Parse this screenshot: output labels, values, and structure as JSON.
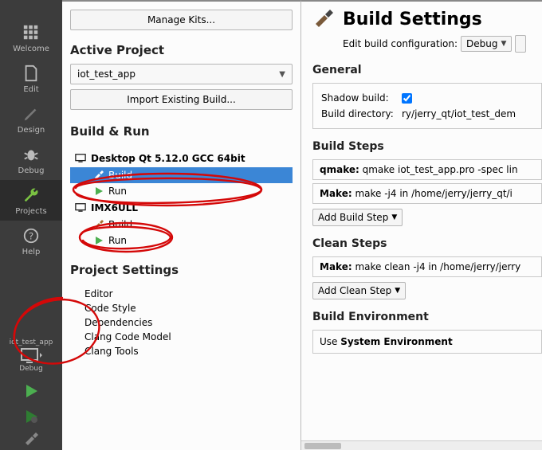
{
  "leftbar": {
    "welcome": "Welcome",
    "edit": "Edit",
    "design": "Design",
    "debug": "Debug",
    "projects": "Projects",
    "help": "Help",
    "kit_project": "iot_test_app",
    "kit_mode": "Debug"
  },
  "middle": {
    "manage_kits": "Manage Kits...",
    "active_project_title": "Active Project",
    "active_project_value": "iot_test_app",
    "import_build": "Import Existing Build...",
    "build_run_title": "Build & Run",
    "kit1": {
      "name": "Desktop Qt 5.12.0 GCC 64bit",
      "build": "Build",
      "run": "Run"
    },
    "kit2": {
      "name": "IMX6ULL",
      "build": "Build",
      "run": "Run"
    },
    "project_settings_title": "Project Settings",
    "settings": [
      "Editor",
      "Code Style",
      "Dependencies",
      "Clang Code Model",
      "Clang Tools"
    ]
  },
  "right": {
    "title": "Build Settings",
    "edit_config_label": "Edit build configuration:",
    "edit_config_value": "Debug",
    "general_title": "General",
    "shadow_label": "Shadow build:",
    "shadow_checked": true,
    "build_dir_label": "Build directory:",
    "build_dir_value": "ry/jerry_qt/iot_test_dem",
    "build_steps_title": "Build Steps",
    "qmake_label": "qmake:",
    "qmake_value": "qmake iot_test_app.pro -spec lin",
    "make_label": "Make:",
    "make_value": "make -j4 in /home/jerry/jerry_qt/i",
    "add_build_step": "Add Build Step",
    "clean_steps_title": "Clean Steps",
    "clean_make_label": "Make:",
    "clean_make_value": "make clean -j4 in /home/jerry/jerry",
    "add_clean_step": "Add Clean Step",
    "build_env_title": "Build Environment",
    "env_use": "Use ",
    "env_value": "System Environment"
  }
}
